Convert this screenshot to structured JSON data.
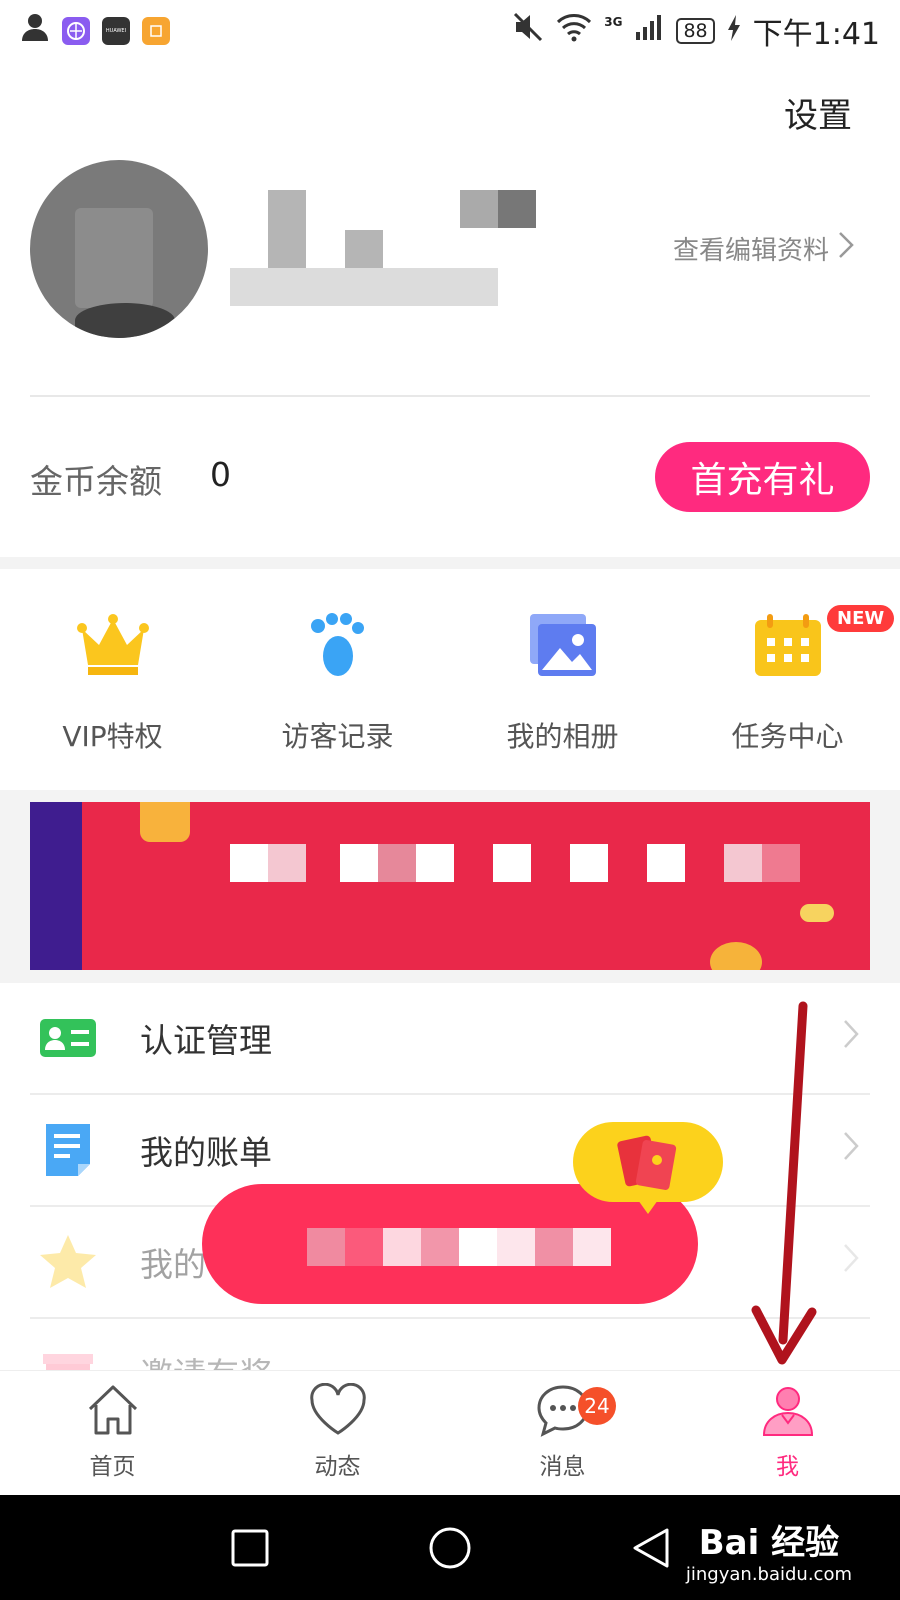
{
  "status_bar": {
    "apps": [
      "person-icon",
      "browser-icon",
      "huawei-icon",
      "gift-app-icon"
    ],
    "huawei_text": "HUAWEI",
    "network": "3G",
    "battery": "88",
    "time": "下午1:41"
  },
  "header": {
    "settings": "设置",
    "edit_profile": "查看编辑资料"
  },
  "wallet": {
    "label": "金币余额",
    "value": "0",
    "recharge": "首充有礼"
  },
  "shortcuts": [
    {
      "label": "VIP特权",
      "icon": "crown-icon",
      "color": "#fbc61e"
    },
    {
      "label": "访客记录",
      "icon": "footprint-icon",
      "color": "#3aa4f5"
    },
    {
      "label": "我的相册",
      "icon": "album-icon",
      "color": "#5e7cf0"
    },
    {
      "label": "任务中心",
      "icon": "calendar-icon",
      "color": "#f9c51b",
      "badge": "NEW"
    }
  ],
  "menu": [
    {
      "label": "认证管理",
      "icon": "id-card-icon",
      "color": "#33c25a"
    },
    {
      "label": "我的账单",
      "icon": "bill-icon",
      "color": "#4aa8f5"
    },
    {
      "label": "我的",
      "icon": "star-icon",
      "color": "#fbd242"
    },
    {
      "label": "邀请有奖",
      "icon": "gift-icon",
      "color": "#ff6a8b"
    }
  ],
  "tabs": [
    {
      "label": "首页",
      "icon": "home-icon"
    },
    {
      "label": "动态",
      "icon": "heart-icon"
    },
    {
      "label": "消息",
      "icon": "chat-icon",
      "badge": "24"
    },
    {
      "label": "我",
      "icon": "profile-icon",
      "active": true
    }
  ],
  "colors": {
    "accent": "#ff2a7f",
    "banner": "#e9284a",
    "popup": "#fe3059",
    "arrow": "#b0131d"
  },
  "watermark": {
    "logo": "Bai 经验",
    "url": "jingyan.baidu.com"
  }
}
